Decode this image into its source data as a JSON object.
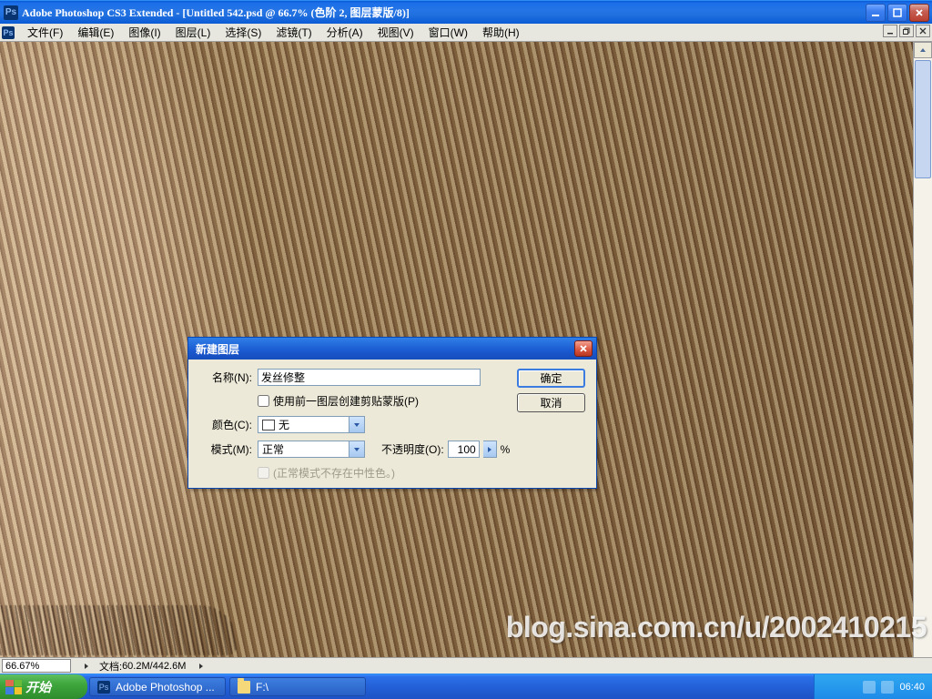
{
  "title_bar": {
    "text": "Adobe Photoshop CS3 Extended - [Untitled 542.psd @ 66.7% (色阶 2, 图层蒙版/8)]"
  },
  "menu": {
    "items": [
      "文件(F)",
      "编辑(E)",
      "图像(I)",
      "图层(L)",
      "选择(S)",
      "滤镜(T)",
      "分析(A)",
      "视图(V)",
      "窗口(W)",
      "帮助(H)"
    ]
  },
  "status": {
    "zoom": "66.67%",
    "doc_label": "文档:",
    "doc_sizes": "60.2M/442.6M"
  },
  "dialog": {
    "title": "新建图层",
    "name_label": "名称(N):",
    "name_value": "发丝修整",
    "clip_label": "使用前一图层创建剪贴蒙版(P)",
    "clip_checked": false,
    "color_label": "颜色(C):",
    "color_value": "无",
    "mode_label": "模式(M):",
    "mode_value": "正常",
    "opacity_label": "不透明度(O):",
    "opacity_value": "100",
    "opacity_suffix": "%",
    "neutral_label": "(正常模式不存在中性色。)",
    "neutral_enabled": false,
    "ok": "确定",
    "cancel": "取消"
  },
  "taskbar": {
    "start": "开始",
    "buttons": [
      {
        "icon": "ps",
        "label": "Adobe Photoshop ..."
      },
      {
        "icon": "folder",
        "label": "F:\\"
      }
    ],
    "clock": "06:40"
  },
  "watermark": "blog.sina.com.cn/u/2002410215"
}
